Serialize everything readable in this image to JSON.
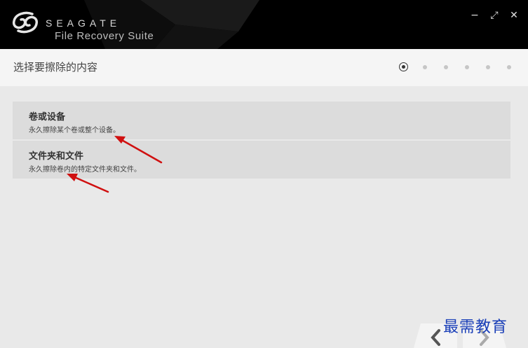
{
  "titlebar": {
    "brand": "SEAGATE",
    "product": "File Recovery Suite",
    "controls": {
      "minimize": "−",
      "restore": "⤢",
      "close": "✕"
    }
  },
  "header": {
    "title": "选择要擦除的内容",
    "steps_total": 6,
    "current_step": 1
  },
  "options": [
    {
      "title": "卷或设备",
      "description": "永久擦除某个卷或整个设备。"
    },
    {
      "title": "文件夹和文件",
      "description": "永久擦除卷内的特定文件夹和文件。"
    }
  ],
  "icons": {
    "logo": "seagate-logo-icon",
    "back": "chevron-left-icon",
    "next": "chevron-right-icon"
  },
  "colors": {
    "titlebar": "#000000",
    "header": "#f5f5f5",
    "option": "#dcdcdc",
    "arrow": "#d01010",
    "watermark": "#1a3fb8"
  },
  "watermark": "最需教育"
}
